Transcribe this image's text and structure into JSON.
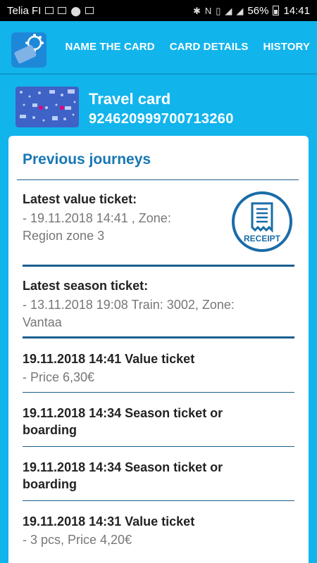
{
  "status_bar": {
    "carrier": "Telia FI",
    "battery": "56%",
    "time": "14:41"
  },
  "app_bar": {
    "logo_icon": "travel-card-logo-icon",
    "tabs": [
      "NAME THE CARD",
      "CARD DETAILS",
      "HISTORY"
    ]
  },
  "card": {
    "title": "Travel card",
    "number": "924620999700713260"
  },
  "journeys": {
    "heading": "Previous journeys",
    "value_ticket": {
      "label": "Latest value ticket:",
      "line1": "- 19.11.2018 14:41 , Zone:",
      "line2": "Region zone 3",
      "receipt_label": "RECEIPT"
    },
    "season_ticket": {
      "label": "Latest season ticket:",
      "line1": "- 13.11.2018 19:08 Train: 3002, Zone:",
      "line2": "Vantaa"
    },
    "history": [
      {
        "title": "19.11.2018 14:41 Value ticket",
        "sub": "- Price 6,30€"
      },
      {
        "title_line1": "19.11.2018 14:34 Season ticket or",
        "title_line2": "boarding"
      },
      {
        "title_line1": "19.11.2018 14:34 Season ticket or",
        "title_line2": "boarding"
      },
      {
        "title": "19.11.2018 14:31 Value ticket",
        "sub": "- 3 pcs, Price 4,20€"
      }
    ]
  },
  "colors": {
    "background": "#12b4ec",
    "accent_blue": "#1677b3",
    "rule": "#1a5f8e"
  }
}
